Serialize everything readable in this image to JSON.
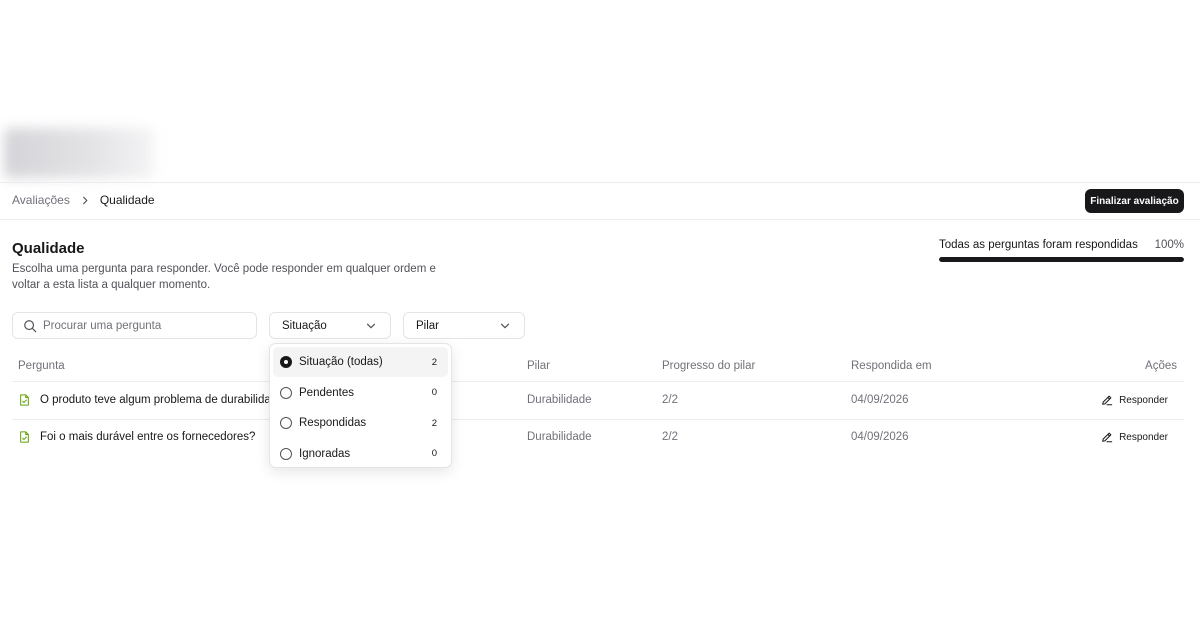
{
  "breadcrumb": {
    "parent": "Avaliações",
    "current": "Qualidade"
  },
  "header": {
    "finalize_label": "Finalizar avaliação"
  },
  "page": {
    "title": "Qualidade",
    "description": "Escolha uma pergunta para responder. Você pode responder em qualquer ordem e voltar a esta lista a qualquer momento."
  },
  "progress": {
    "label": "Todas as perguntas foram respondidas",
    "percent_text": "100%",
    "value": 1.0
  },
  "search": {
    "placeholder": "Procurar uma pergunta",
    "value": ""
  },
  "filters": {
    "situacao_label": "Situação",
    "pilar_label": "Pilar"
  },
  "table": {
    "headers": {
      "pergunta": "Pergunta",
      "pilar": "Pilar",
      "progresso": "Progresso do pilar",
      "respondida": "Respondida em",
      "acoes": "Ações"
    },
    "rows": [
      {
        "question": "O produto teve algum problema de durabilidade?",
        "pillar": "Durabilidade",
        "progress": "2/2",
        "answered_at": "04/09/2026",
        "action": "Responder"
      },
      {
        "question": "Foi o mais durável entre os fornecedores?",
        "pillar": "Durabilidade",
        "progress": "2/2",
        "answered_at": "04/09/2026",
        "action": "Responder"
      }
    ]
  },
  "dropdown": {
    "options": [
      {
        "label": "Situação (todas)",
        "count": "2",
        "selected": true
      },
      {
        "label": "Pendentes",
        "count": "0",
        "selected": false
      },
      {
        "label": "Respondidas",
        "count": "2",
        "selected": false
      },
      {
        "label": "Ignoradas",
        "count": "0",
        "selected": false
      }
    ]
  },
  "colors": {
    "primary": "#18181b",
    "muted": "#71717a",
    "border": "#e4e4e7",
    "success_icon": "#65a30d"
  },
  "icons": {
    "breadcrumb_separator": "chevron-right-icon",
    "search": "search-icon",
    "select": "chevron-down-icon",
    "question": "file-check-icon",
    "action": "pencil-icon"
  }
}
